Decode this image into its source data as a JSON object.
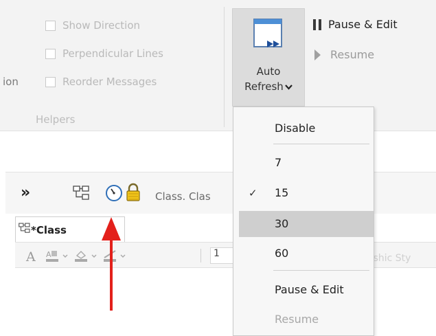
{
  "ribbon": {
    "helpers": {
      "checkboxes": [
        "Show Direction",
        "Perpendicular Lines",
        "Reorder Messages"
      ],
      "truncated_label": "ion",
      "group_label": "Helpers"
    },
    "auto_refresh": {
      "line1": "Auto",
      "line2": "Refresh"
    },
    "pause_edit": "Pause & Edit",
    "resume": "Resume"
  },
  "diagram": {
    "chevrons": "»",
    "breadcrumb": "Class. Clas",
    "tab_label": "*Class",
    "format_bar": {
      "font_size": "1",
      "ghost_text": "ashic Sty"
    }
  },
  "menu": {
    "items": [
      {
        "label": "Disable",
        "checked": false,
        "highlighted": false,
        "disabled": false
      },
      {
        "label": "7",
        "checked": false,
        "highlighted": false,
        "disabled": false
      },
      {
        "label": "15",
        "checked": true,
        "highlighted": false,
        "disabled": false
      },
      {
        "label": "30",
        "checked": false,
        "highlighted": true,
        "disabled": false
      },
      {
        "label": "60",
        "checked": false,
        "highlighted": false,
        "disabled": false
      },
      {
        "label": "Pause & Edit",
        "checked": false,
        "highlighted": false,
        "disabled": false
      },
      {
        "label": "Resume",
        "checked": false,
        "highlighted": false,
        "disabled": true
      }
    ],
    "check_glyph": "✓"
  },
  "colors": {
    "annotation_arrow": "#e3201b",
    "menu_highlight": "#cfcfcf"
  }
}
